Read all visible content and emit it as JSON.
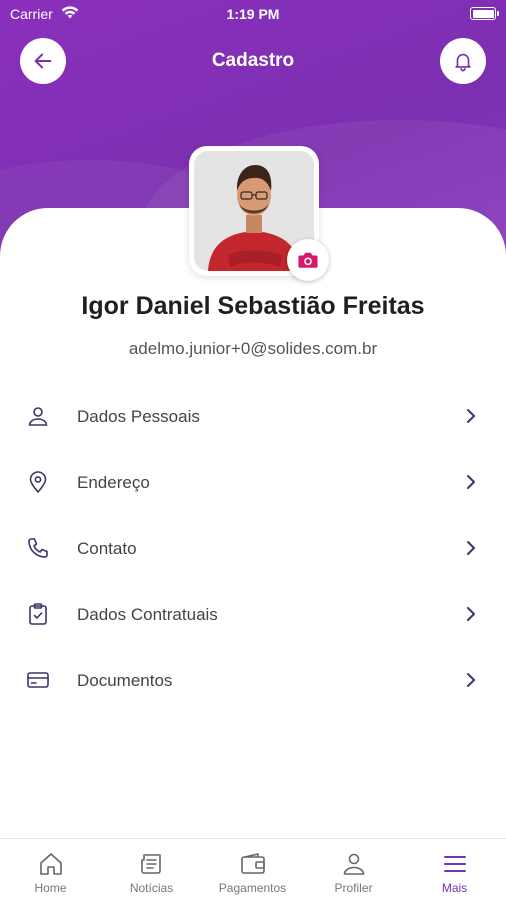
{
  "status_bar": {
    "carrier": "Carrier",
    "time": "1:19 PM"
  },
  "header": {
    "title": "Cadastro",
    "back_icon": "arrow-left-icon",
    "bell_icon": "bell-icon"
  },
  "colors": {
    "brand": "#7c2fb0",
    "chevron": "#3b3569",
    "icon": "#3b3569",
    "camera": "#d6196e"
  },
  "profile": {
    "name": "Igor Daniel Sebastião Freitas",
    "email": "adelmo.junior+0@solides.com.br",
    "camera_icon": "camera-icon"
  },
  "menu": [
    {
      "label": "Dados Pessoais",
      "icon": "user-icon"
    },
    {
      "label": "Endereço",
      "icon": "location-pin-icon"
    },
    {
      "label": "Contato",
      "icon": "phone-icon"
    },
    {
      "label": "Dados Contratuais",
      "icon": "clipboard-check-icon"
    },
    {
      "label": "Documentos",
      "icon": "card-icon"
    }
  ],
  "tabs": [
    {
      "label": "Home",
      "icon": "home-icon",
      "active": false
    },
    {
      "label": "Notícias",
      "icon": "news-icon",
      "active": false
    },
    {
      "label": "Pagamentos",
      "icon": "wallet-icon",
      "active": false
    },
    {
      "label": "Profiler",
      "icon": "profile-icon",
      "active": false
    },
    {
      "label": "Mais",
      "icon": "menu-icon",
      "active": true
    }
  ]
}
